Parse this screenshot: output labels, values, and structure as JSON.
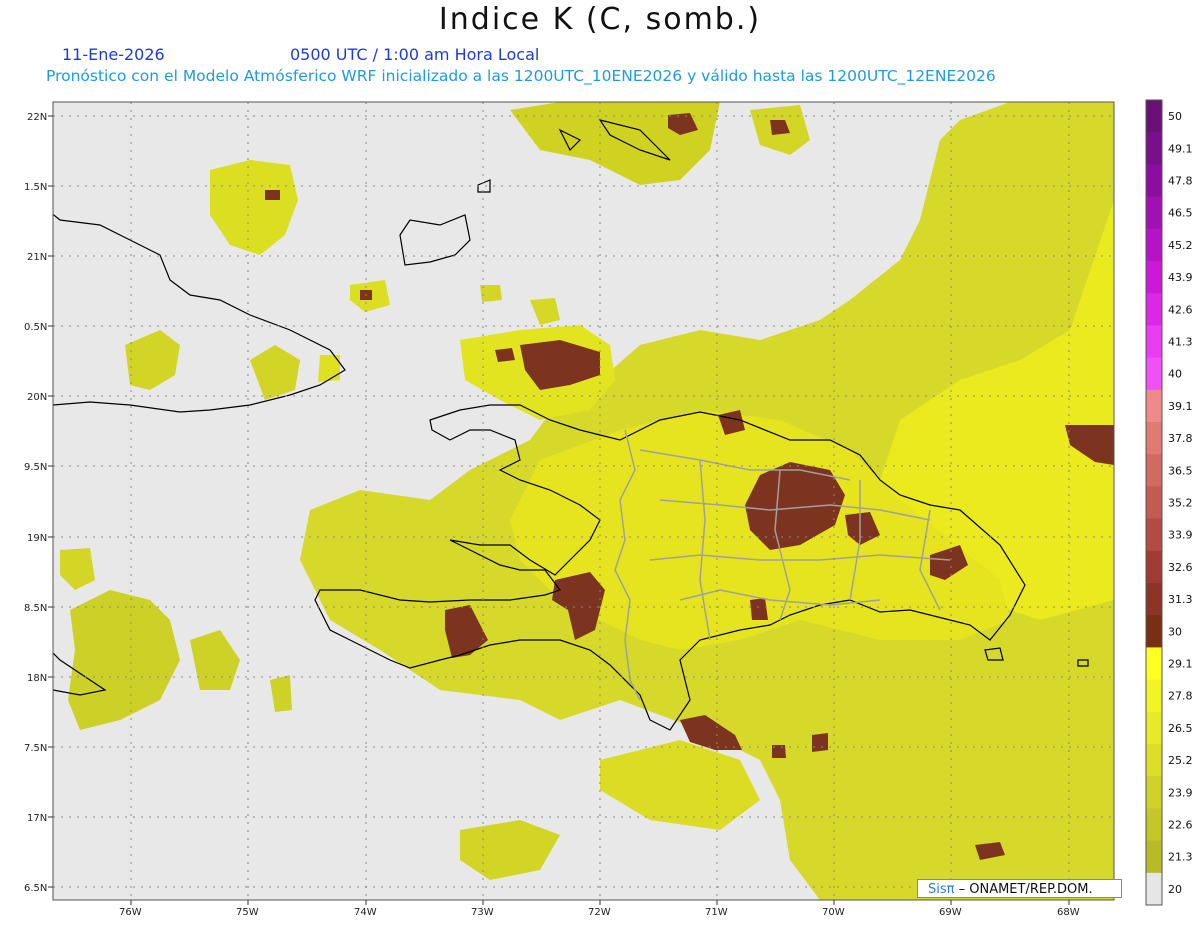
{
  "title": "Indice K (C, somb.)",
  "date": "11-Ene-2026",
  "time": "0500 UTC / 1:00 am Hora Local",
  "model_line": "Pronóstico con el Modelo Atmósferico WRF inicializado a las 1200UTC_10ENE2026 y válido hasta las  1200UTC_12ENE2026",
  "credit": {
    "logo": "Sisπ",
    "text": "– ONAMET/REP.DOM."
  },
  "map": {
    "lat_labels": [
      "22N",
      "1.5N",
      "21N",
      "0.5N",
      "20N",
      "9.5N",
      "19N",
      "8.5N",
      "18N",
      "7.5N",
      "17N",
      "6.5N"
    ],
    "lon_labels": [
      "76W",
      "75W",
      "74W",
      "73W",
      "72W",
      "71W",
      "70W",
      "69W",
      "68W"
    ],
    "background_color": "#e8e8e8",
    "coast_color": "#000000",
    "border_color": "#a0a0a0"
  },
  "colorbar": {
    "labels": [
      "50",
      "49.1",
      "47.8",
      "46.5",
      "45.2",
      "43.9",
      "42.6",
      "41.3",
      "40",
      "39.1",
      "37.8",
      "36.5",
      "35.2",
      "33.9",
      "32.6",
      "31.3",
      "30",
      "29.1",
      "27.8",
      "26.5",
      "25.2",
      "23.9",
      "22.6",
      "21.3",
      "20"
    ],
    "colors": [
      "#6a1078",
      "#7a0f8c",
      "#8c0ea0",
      "#a20fb4",
      "#b812c8",
      "#cc18d8",
      "#dc28e6",
      "#ea3cf0",
      "#f050f5",
      "#f08a8a",
      "#e07a72",
      "#d26a62",
      "#c45a52",
      "#b44a44",
      "#a03c34",
      "#8c3426",
      "#7a2e14",
      "#ffff24",
      "#f4f424",
      "#e8ea26",
      "#dcde28",
      "#d0d22a",
      "#c4c62a",
      "#b8ba28",
      "#e6e6e6"
    ]
  }
}
